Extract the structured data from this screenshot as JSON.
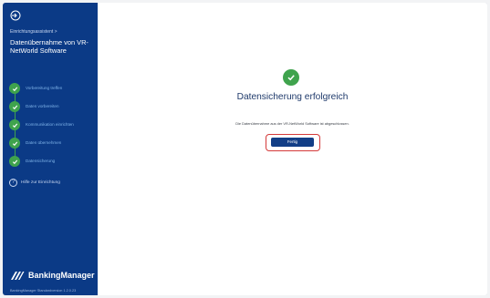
{
  "sidebar": {
    "breadcrumb": "Einrichtungsassistent >",
    "title": "Datenübernahme von VR-NetWorld Software",
    "steps": [
      {
        "label": "Vorbereitung treffen",
        "status": "done"
      },
      {
        "label": "Daten vorbereiten",
        "status": "done"
      },
      {
        "label": "Kommunikation einrichten",
        "status": "done"
      },
      {
        "label": "Daten übernehmen",
        "status": "done"
      },
      {
        "label": "Datensicherung",
        "status": "done"
      }
    ],
    "help_label": "Hilfe zur Einrichtung",
    "brand_name": "BankingManager",
    "version": "BankingManager Standardversion 1.2.0.23"
  },
  "main": {
    "heading": "Datensicherung erfolgreich",
    "description": "Die Datenübernahme aus der VR-NetWorld Software ist abgeschlossen.",
    "finish_button": "Fertig"
  },
  "colors": {
    "sidebar_bg": "#0b3a86",
    "success_green": "#3fa34d",
    "button_bg": "#123e86",
    "highlight_red": "#d43a3a"
  }
}
